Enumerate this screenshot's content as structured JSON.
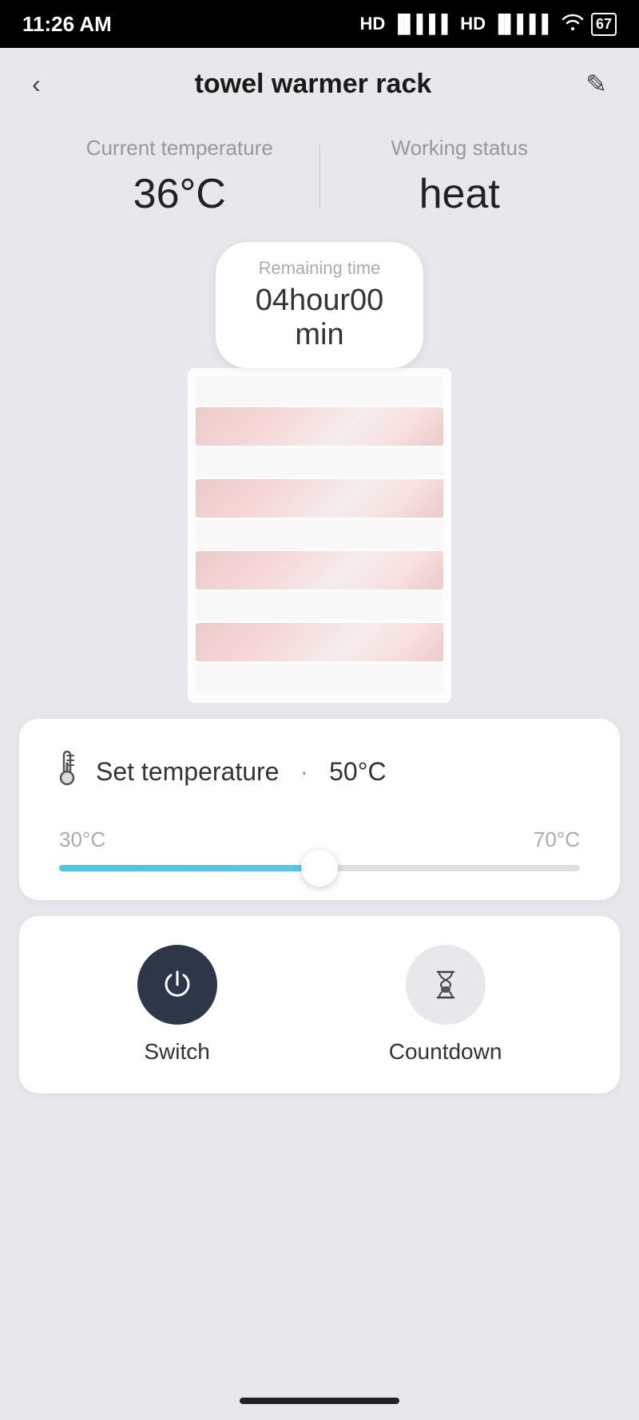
{
  "statusBar": {
    "time": "11:26 AM",
    "battery": "67",
    "signal": "HD"
  },
  "header": {
    "title": "towel warmer rack",
    "backLabel": "‹",
    "editLabel": "✎"
  },
  "infoSection": {
    "currentTempLabel": "Current temperature",
    "currentTempValue": "36°C",
    "workingStatusLabel": "Working status",
    "workingStatusValue": "heat"
  },
  "remainingTime": {
    "label": "Remaining time",
    "value": "04hour00",
    "unit": "min"
  },
  "tempCard": {
    "setTempLabel": "Set temperature",
    "dot": "·",
    "setTempValue": "50°C",
    "minTemp": "30°C",
    "maxTemp": "70°C",
    "sliderPercent": 50
  },
  "controls": {
    "switchLabel": "Switch",
    "countdownLabel": "Countdown"
  }
}
